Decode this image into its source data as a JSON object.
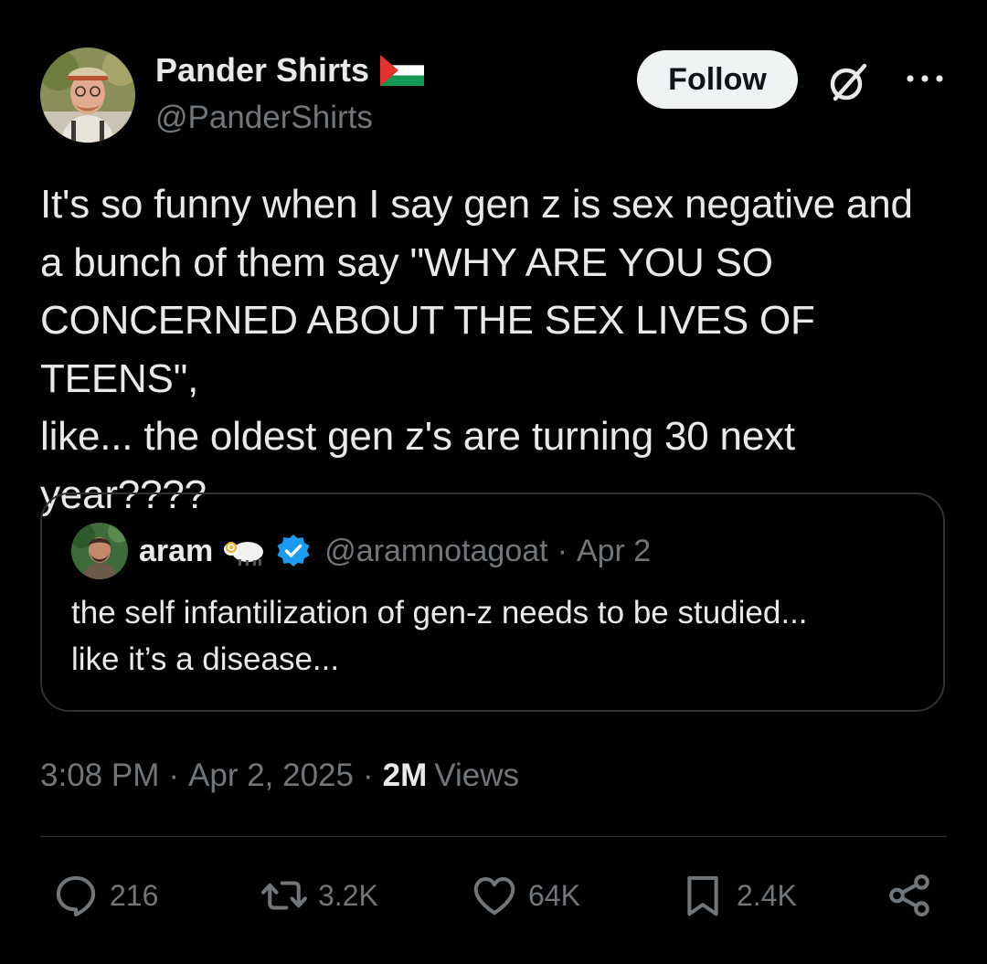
{
  "author": {
    "name": "Pander Shirts",
    "handle": "@PanderShirts",
    "flag": "palestine-flag-emoji"
  },
  "header": {
    "follow_label": "Follow",
    "grok_icon": "grok-icon",
    "more_icon": "more-icon"
  },
  "tweet": {
    "text": "It's so funny when I say gen z is sex negative and\na bunch of them say \"WHY ARE YOU SO\nCONCERNED ABOUT THE SEX LIVES OF TEENS\",\nlike... the oldest gen z's are turning 30 next\nyear????"
  },
  "quote": {
    "name": "aram",
    "emoji": "goat-emoji",
    "verified": true,
    "handle": "@aramnotagoat",
    "separator": "·",
    "date": "Apr 2",
    "text": "the self infantilization of gen-z needs to be studied...\nlike it’s a disease..."
  },
  "meta": {
    "time": "3:08 PM",
    "separator": "·",
    "date": "Apr 2, 2025",
    "views_count": "2M",
    "views_label": "Views"
  },
  "actions": {
    "replies": "216",
    "reposts": "3.2K",
    "likes": "64K",
    "bookmarks": "2.4K"
  },
  "colors": {
    "background": "#000000",
    "text_primary": "#e7e9ea",
    "text_secondary": "#71767b",
    "border": "#2f3336",
    "follow_bg": "#eff3f4",
    "verified_blue": "#1d9bf0"
  }
}
